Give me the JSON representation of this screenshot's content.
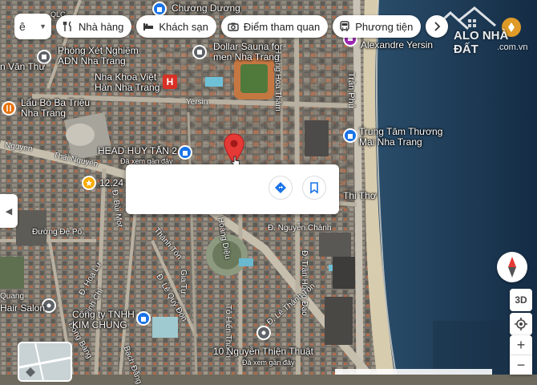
{
  "toolbar": {
    "mode_label": "ê",
    "chips": [
      {
        "label": "Nhà hàng",
        "icon": "fork-knife-icon"
      },
      {
        "label": "Khách sạn",
        "icon": "bed-icon"
      },
      {
        "label": "Điểm tham quan",
        "icon": "camera-icon"
      },
      {
        "label": "Phương tiện",
        "icon": "bus-icon"
      }
    ]
  },
  "watermark": {
    "brand": "ALO NHÀ ĐẤT",
    "domain": ".com.vn"
  },
  "places": {
    "chuong_duong": "Chương Dương",
    "qlc": "QLC",
    "phong_xet_nghiem": "Phòng Xét Nghiệm\nADN Nha Trang",
    "dollar_sauna": "Dollar Sauna for\nmen Nha Trang",
    "nha_khoa": "Nha Khoa Việt\nHàn Nha Trang",
    "alexandre": "Alexandre Yersin",
    "lau_bo": "Lẩu Bò Ba Triệu\nNha Trang",
    "trung_tam": "Trung Tâm Thương\nMại Nha Trang",
    "head_huy_tan": "HEAD HUY TẤN 2",
    "head_note": "Đã xem gần đây",
    "score": "12.24",
    "thi_tho": "Thi Thơ",
    "hair_salon": "Hair Salon",
    "cong_ty": "Công ty TNHH\nKIM CHUNG",
    "nguyen_thien_thuat": "10 Nguyễn Thiện Thuật",
    "ntt_note": "Đã xem gần đây",
    "van_thu": "n Văn Thư"
  },
  "streets": {
    "yersin": "Yersin",
    "tran_phu": "Trần Phú",
    "thai_nguyen": "Thái Nguyên",
    "nguyen": "Nguyen",
    "hoang_hoa_tham": "Hoàng Hoa Thám",
    "nguyen_chanh": "Đ. Nguyễn Chánh",
    "tran_hung_dao": "Đ. Trần Hưng Đạo",
    "le_thanh_ton": "Đ. Lê Thánh Tôn",
    "to_hien_thanh": "Tô Hiến Thành",
    "le_quy_don": "Đ. Lê Quý Đôn",
    "duong_de_po": "Đường Đệ Pô",
    "hoang_dieu": "Hoàng Diệu",
    "bach_dang": "Bạch Đằng",
    "hong_bang": "Hồng Bàng",
    "hoa_lu": "Đ. Hoa Lư",
    "dinh_chi": "Đinh Chi",
    "bui_mot": "Đ. Bùi Mọt",
    "thanh_ton": "Thánh Tôn",
    "gia_tu": "Gia Tự",
    "quang": "Quang"
  },
  "controls": {
    "view_3d": "3D",
    "zoom_in": "+",
    "zoom_out": "−"
  },
  "colors": {
    "pin_red": "#e53935",
    "poi_blue": "#1a73e8",
    "poi_orange": "#e8710a",
    "poi_gray": "#5f6368",
    "sea": "#1f3a55"
  }
}
